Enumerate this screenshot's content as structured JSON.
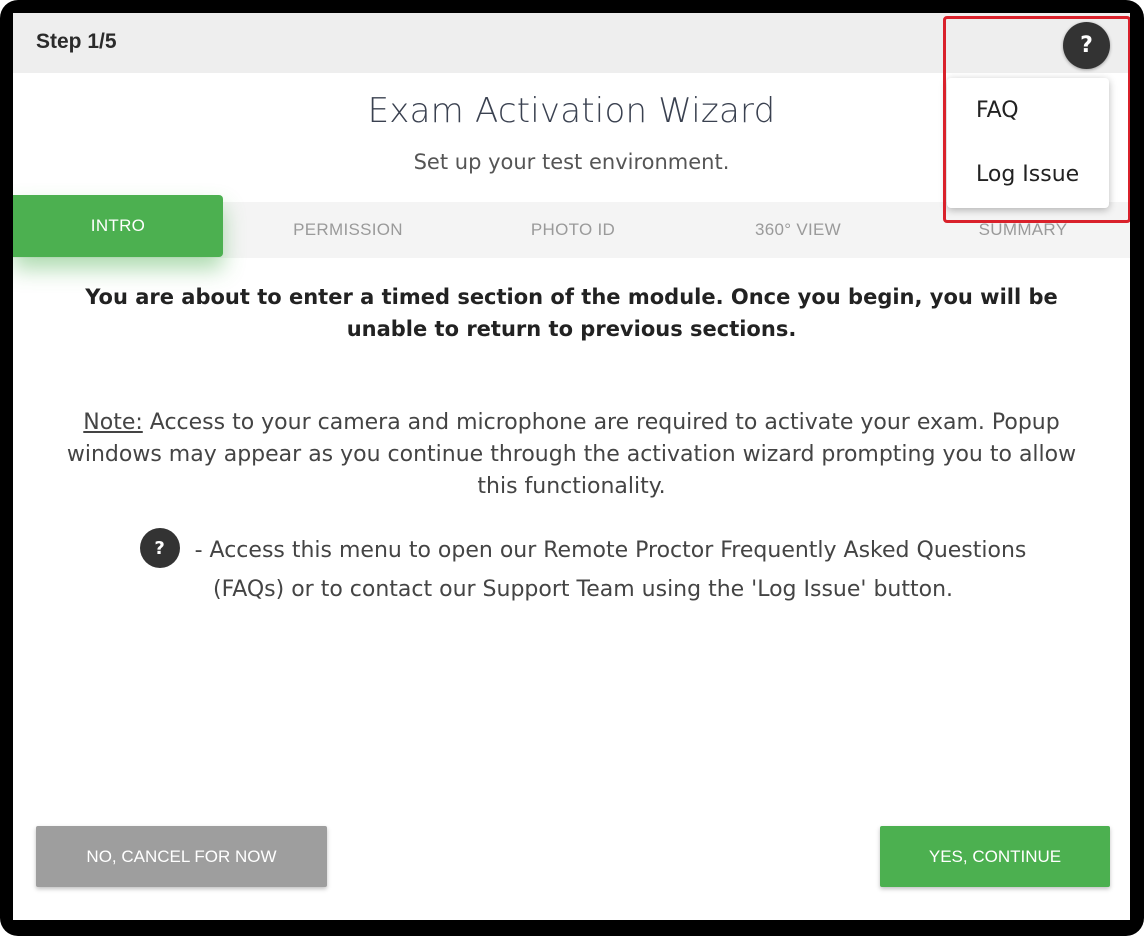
{
  "header": {
    "step": "Step 1/5",
    "help_icon": "question-mark-icon"
  },
  "title": "Exam Activation Wizard",
  "subtitle": "Set up your test environment.",
  "tabs": [
    {
      "label": "INTRO",
      "active": true
    },
    {
      "label": "PERMISSION",
      "active": false
    },
    {
      "label": "PHOTO ID",
      "active": false
    },
    {
      "label": "360° VIEW",
      "active": false
    },
    {
      "label": "SUMMARY",
      "active": false
    }
  ],
  "warning": "You are about to enter a timed section of the module. Once you begin, you will be unable to return to previous sections.",
  "note": {
    "label": "Note:",
    "text": " Access to your camera and microphone are required to activate your exam. Popup windows may appear as you continue through the activation wizard prompting you to allow this functionality."
  },
  "help_info": {
    "icon_glyph": "?",
    "text": " - Access this menu to open our Remote Proctor Frequently Asked Questions (FAQs) or to contact our Support Team using the 'Log Issue' button."
  },
  "dropdown": {
    "items": [
      "FAQ",
      "Log Issue"
    ]
  },
  "buttons": {
    "cancel": "NO, CANCEL FOR NOW",
    "continue": "YES, CONTINUE"
  },
  "colors": {
    "accent": "#4cb050",
    "cancel": "#9e9e9e",
    "highlight": "#d9212b",
    "icon_bg": "#333333"
  }
}
